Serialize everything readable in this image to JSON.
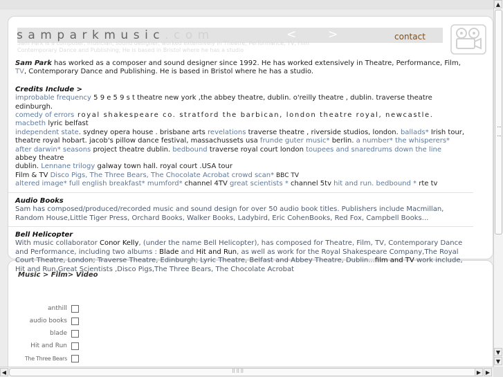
{
  "header": {
    "logo_main": "samparkmusic",
    "logo_suffix": ".com",
    "prev_arrow": "<",
    "next_arrow": ">",
    "contact": "contact",
    "ghost_line_1": "Sam Park is a composer, musician, sound designer, worked extensively in Theatre, Performance, TV, Film",
    "ghost_line_2": "Contemporary Dance and Publishing; He is based in Bristol where he has a studio",
    "logo_icon": "film-camera-icon"
  },
  "intro": {
    "name": "Sam Park",
    "text_a": " has worked as a composer and sound  designer since 1992. He has worked extensively in Theatre, Performance, Film, ",
    "tv": "TV",
    "text_b": ", Contemporary Dance  and Publishing. He is based in Bristol where he has a studio."
  },
  "credits": {
    "heading": "Credits Include >",
    "l1": {
      "a": "improbable frequency",
      "b": " 5 9 e  5 9  s t  theatre new york ,the abbey theatre, dublin. o'reilly  theatre , dublin. traverse theatre edinburgh."
    },
    "l2": {
      "a": "comedy of errors",
      "b": "    royal shakespeare co. stratford  the barbican, london  theatre royal, newcastle. ",
      "c": "macbeth",
      "d": "  lyric belfast"
    },
    "l3": {
      "a": "independent state",
      "b": ". sydney  opera  house . brisbane arts ",
      "c": "revelations",
      "d": "  traverse theatre , riverside studios, london. ",
      "e": "ballads*",
      "f": "  Irish tour,"
    },
    "l4": {
      "a": "theatre royal hobart.  jacob's pillow dance festival, massachussets  usa  ",
      "b": "frunde guter music*",
      "c": " berlin.  ",
      "d": "a number*  the whisperers*"
    },
    "l5": {
      "a": "after darwin* seasons",
      "b": " project theatre dublin.  ",
      "c": "bedbound",
      "d": "  traverse  royal court london  ",
      "e": "toupees and snaredrums  down the line",
      "f": "   abbey theatre"
    },
    "l6": {
      "a": "dublin.   ",
      "b": "Lennane trilogy",
      "c": " galway town hall. royal court .USA tour"
    },
    "l7": {
      "a": "Film & TV     ",
      "b": "Disco Pigs,  The Three Bears,  The Chocolate Acrobat   crowd scan*",
      "c": "  BBC TV"
    },
    "l8": {
      "a": "altered image* full english breakfast* mumford*",
      "b": " channel 4TV   ",
      "c": "great scientists *",
      "d": " channel 5tv   ",
      "e": "hit and run. bedbound *",
      "f": "  rte tv"
    }
  },
  "audio": {
    "heading": "Audio Books",
    "text": "Sam has  composed/produced/recorded music and sound design for over 50 audio book titles. Publishers include Macmillan, Random House,Little Tiger Press, Orchard Books, Walker Books, Ladybird, Eric CohenBooks, Red Fox, Campbell Books..."
  },
  "bell": {
    "heading": "Bell Helicopter",
    "t1": "With music collaborator ",
    "t2": "Conor Kelly",
    "t3": ", (under the name Bell Helicopter), has composed for Theatre, Film, TV, Contemporary Dance and Performance, including two albums : ",
    "t4": "Blade",
    "t5": " and ",
    "t6": "Hit and Run",
    "t7": ", as well as work for the Royal Shakespeare Company,The Royal Court Theatre, London; Traverse Theatre, Edinburgh; Lyric Theatre, Belfast and Abbey Theatre, Dublin...",
    "t8": "film and TV",
    "t9": "  work include, Hit and Run,Great Scientists ,Disco Pigs,The Three Bears, The Chocolate Acrobat"
  },
  "music": {
    "title": "Music > Film> Video",
    "items": [
      "anthill",
      "audio books",
      "blade",
      "Hit and Run",
      "The Three Bears"
    ]
  },
  "scrollbars": {
    "up": "▲",
    "down": "▼",
    "down2": "▼",
    "left": "◀",
    "right": "▶",
    "right2": "▶",
    "grip_h": "⠿⠿⠿"
  },
  "colors": {
    "link": "#5d7aa0",
    "contact": "#7a4e1e",
    "header_bar": "#e3e3e3"
  }
}
